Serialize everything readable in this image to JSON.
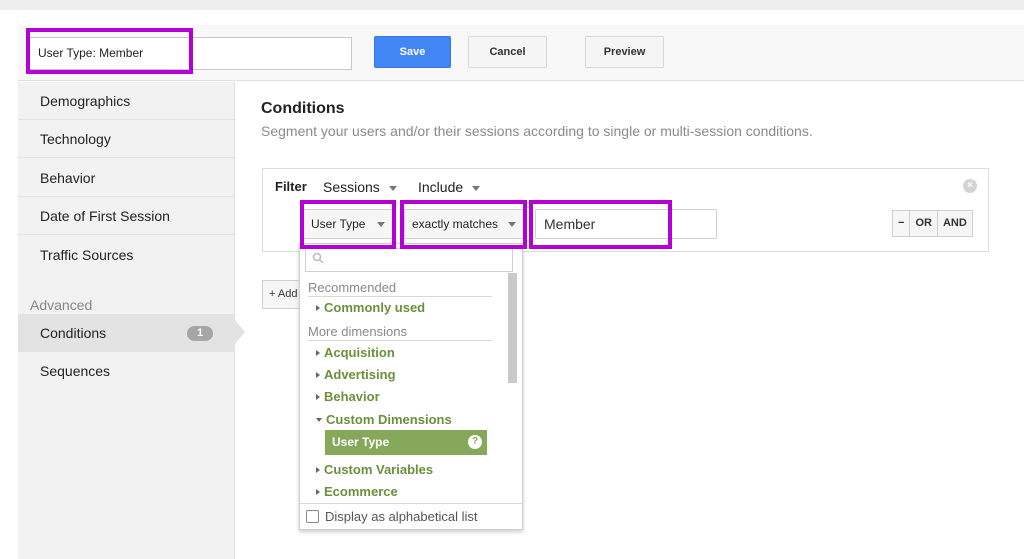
{
  "segment": {
    "name_value": "User Type: Member"
  },
  "toolbar": {
    "save": "Save",
    "cancel": "Cancel",
    "preview": "Preview"
  },
  "sidebar": {
    "items": [
      "Demographics",
      "Technology",
      "Behavior",
      "Date of First Session",
      "Traffic Sources"
    ],
    "advanced_label": "Advanced",
    "advanced_items": [
      {
        "label": "Conditions",
        "badge": "1"
      },
      {
        "label": "Sequences"
      }
    ]
  },
  "main": {
    "title": "Conditions",
    "subtitle": "Segment your users and/or their sessions according to single or multi-session conditions.",
    "filter": {
      "label": "Filter",
      "scope": "Sessions",
      "mode": "Include",
      "dimension": "User Type",
      "operator": "exactly matches",
      "value": "Member",
      "buttons": {
        "minus": "−",
        "or": "OR",
        "and": "AND"
      }
    },
    "add_label": "+ Add Filter"
  },
  "dropdown": {
    "section_recommended": "Recommended",
    "commonly_used": "Commonly used",
    "section_more": "More dimensions",
    "items": [
      "Acquisition",
      "Advertising",
      "Behavior"
    ],
    "custom_dimensions": "Custom Dimensions",
    "selected": "User Type",
    "custom_variables": "Custom Variables",
    "ecommerce": "Ecommerce",
    "footer": "Display as alphabetical list"
  },
  "colors": {
    "highlight": "#b400d4",
    "save_button": "#4285f4",
    "selected_item": "#86a85a",
    "dimension_link": "#6c8f3c"
  }
}
